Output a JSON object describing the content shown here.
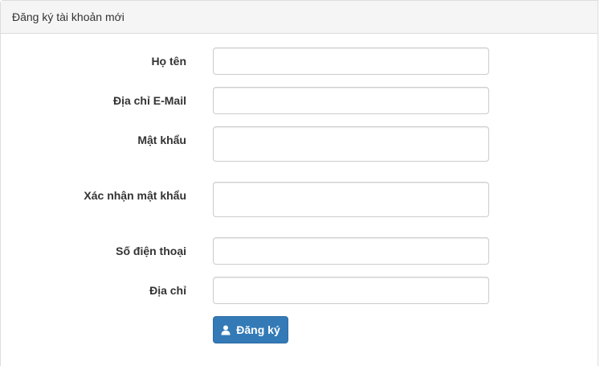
{
  "panel": {
    "title": "Đăng ký tài khoản mới"
  },
  "form": {
    "fields": [
      {
        "label": "Họ tên",
        "value": "",
        "placeholder": ""
      },
      {
        "label": "Địa chỉ E-Mail",
        "value": "",
        "placeholder": ""
      },
      {
        "label": "Mật khẩu",
        "value": "",
        "placeholder": ""
      },
      {
        "label": "Xác nhận mật khẩu",
        "value": "",
        "placeholder": ""
      },
      {
        "label": "Số điện thoại",
        "value": "",
        "placeholder": ""
      },
      {
        "label": "Địa chỉ",
        "value": "",
        "placeholder": ""
      }
    ],
    "submit": {
      "label": "Đăng ký",
      "icon": "user-icon"
    }
  },
  "colors": {
    "primary": "#337ab7",
    "heading_bg": "#f5f5f5",
    "border": "#cccccc"
  }
}
